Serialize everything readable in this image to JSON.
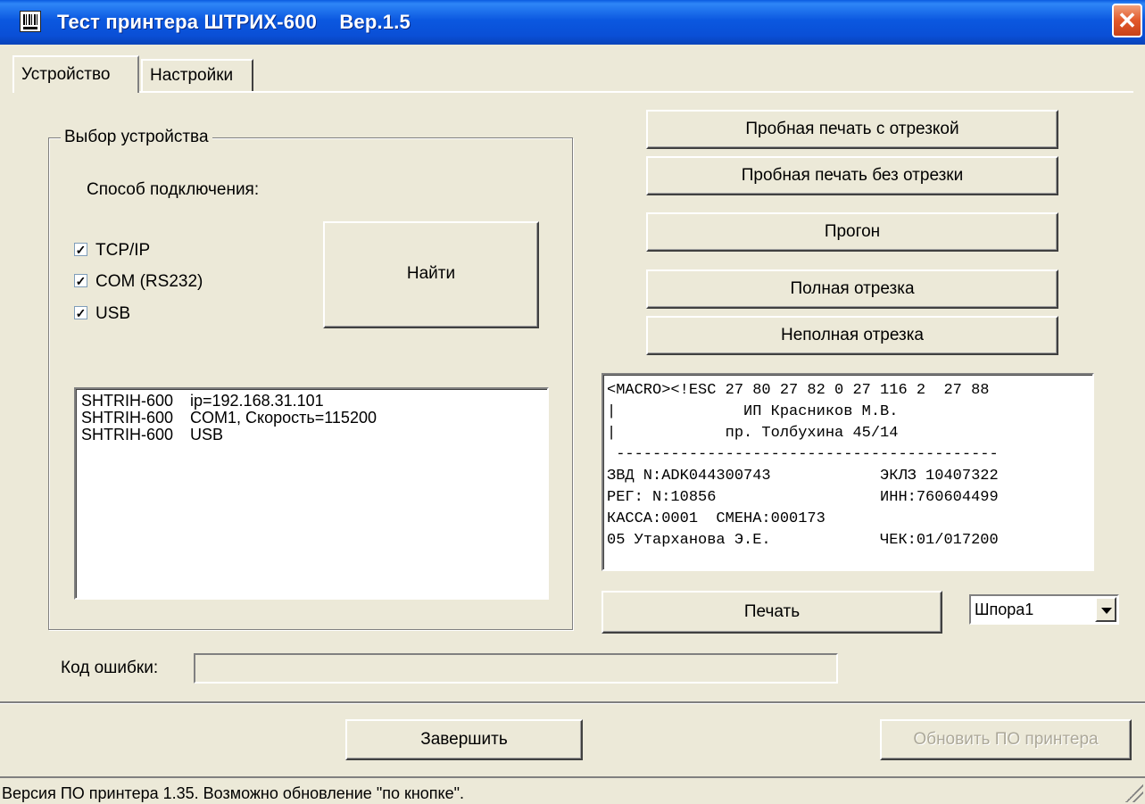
{
  "window": {
    "title": "Тест принтера ШТРИХ-600    Вер.1.5",
    "close_label": "✕"
  },
  "tabs": [
    {
      "label": "Устройство",
      "selected": true
    },
    {
      "label": "Настройки",
      "selected": false
    }
  ],
  "device_group": {
    "legend": "Выбор устройства",
    "connection_label": "Способ подключения:",
    "checkboxes": [
      {
        "label": "TCP/IP",
        "checked": true,
        "mark": "✓"
      },
      {
        "label": "COM (RS232)",
        "checked": true,
        "mark": "✓"
      },
      {
        "label": "USB",
        "checked": true,
        "mark": "✓"
      }
    ],
    "find_button": "Найти",
    "devices": [
      {
        "name": "SHTRIH-600",
        "info": "ip=192.168.31.101"
      },
      {
        "name": "SHTRIH-600",
        "info": "COM1, Скорость=115200"
      },
      {
        "name": "SHTRIH-600",
        "info": "USB"
      }
    ]
  },
  "error": {
    "label": "Код ошибки:",
    "value": ""
  },
  "actions": {
    "print_with_cut": "Пробная печать с отрезкой",
    "print_without_cut": "Пробная печать без отрезки",
    "feed": "Прогон",
    "full_cut": "Полная отрезка",
    "partial_cut": "Неполная отрезка",
    "print": "Печать"
  },
  "receipt": {
    "lines": [
      "<MACRO><!ESC 27 80 27 82 0 27 116 2  27 88",
      "|              ИП Красников М.В.",
      "|            пр. Толбухина 45/14",
      " ------------------------------------------",
      "ЗВД N:ADK044300743            ЭКЛЗ 10407322",
      "РЕГ: N:10856                  ИНН:760604499",
      "КАССА:0001  СМЕНА:000173",
      "05 Утарханова Э.Е.            ЧЕК:01/017200"
    ]
  },
  "template_select": {
    "value": "Шпора1"
  },
  "footer": {
    "exit_button": "Завершить",
    "update_button": "Обновить ПО принтера",
    "update_enabled": false
  },
  "status_bar": {
    "text": "Версия ПО принтера 1.35. Возможно обновление \"по кнопке\"."
  }
}
